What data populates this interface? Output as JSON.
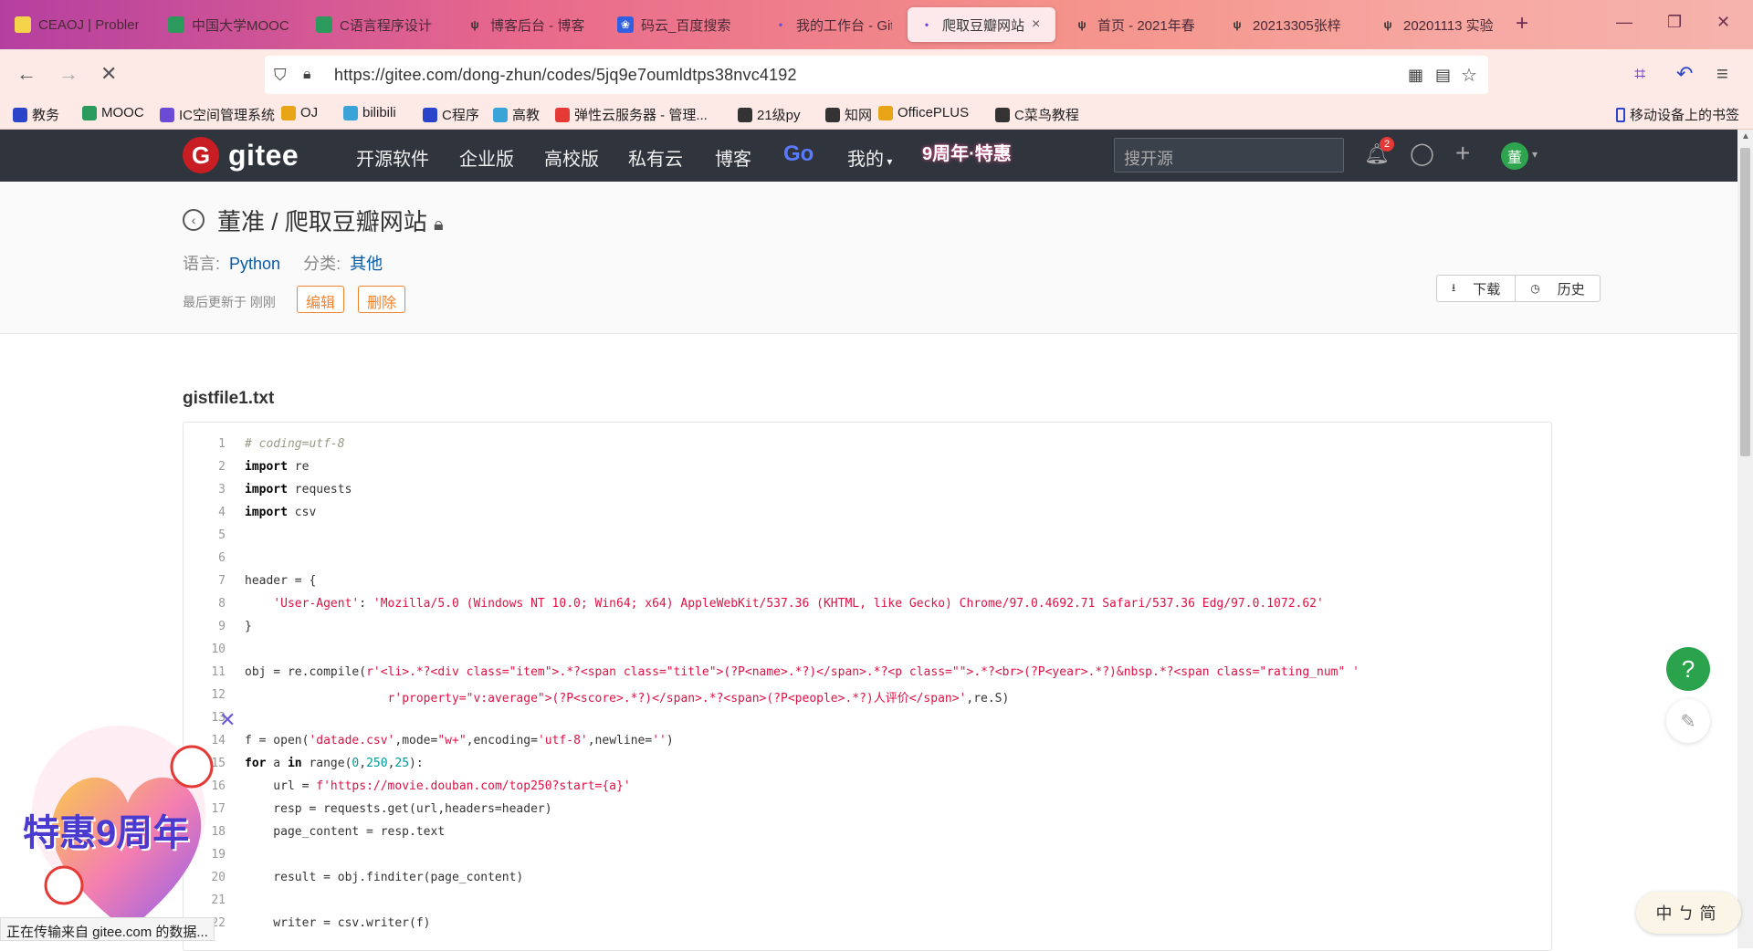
{
  "browser": {
    "tabs": [
      {
        "label": "CEAOJ | Problem",
        "icon": "ceaoj-icon"
      },
      {
        "label": "中国大学MOOC",
        "icon": "mooc-icon"
      },
      {
        "label": "C语言程序设计",
        "icon": "mooc-icon"
      },
      {
        "label": "博客后台 - 博客",
        "icon": "cnblogs-icon"
      },
      {
        "label": "码云_百度搜索",
        "icon": "baidu-icon"
      },
      {
        "label": "我的工作台 - Gitee",
        "icon": "dot-icon"
      },
      {
        "label": "爬取豆瓣网站",
        "icon": "dot-icon",
        "active": true
      },
      {
        "label": "首页 - 2021年春",
        "icon": "cnblogs-icon"
      },
      {
        "label": "20213305张梓",
        "icon": "cnblogs-icon"
      },
      {
        "label": "20201113 实验",
        "icon": "cnblogs-icon"
      }
    ],
    "tab_close": "×",
    "new_tab": "+",
    "url": "https://gitee.com/dong-zhun/codes/5jq9e7oumldtps38nvc4192",
    "bookmarks": [
      "教务",
      "MOOC",
      "IC空间管理系统",
      "OJ",
      "bilibili",
      "C程序",
      "高教",
      "弹性云服务器 - 管理...",
      "21级py",
      "知网",
      "OfficePLUS",
      "C菜鸟教程"
    ],
    "mobile_bookmarks": "移动设备上的书签",
    "status_text": "正在传输来自 gitee.com 的数据..."
  },
  "gitee": {
    "logo_text": "gitee",
    "nav": [
      "开源软件",
      "企业版",
      "高校版",
      "私有云",
      "博客",
      "Go",
      "我的"
    ],
    "anniversary": "9周年·特惠",
    "search_placeholder": "搜开源",
    "notification_count": "2",
    "avatar_text": "董"
  },
  "snippet": {
    "owner": "董准",
    "separator": " / ",
    "name": "爬取豆瓣网站",
    "lang_label": "语言:",
    "lang_value": "Python",
    "cat_label": "分类:",
    "cat_value": "其他",
    "updated": "最后更新于 刚刚",
    "edit": "编辑",
    "delete": "删除",
    "download": "下载",
    "history": "历史",
    "filename": "gistfile1.txt"
  },
  "code_lines": [
    "# coding=utf-8",
    "import re",
    "import requests",
    "import csv",
    "",
    "",
    "header = {",
    "    'User-Agent': 'Mozilla/5.0 (Windows NT 10.0; Win64; x64) AppleWebKit/537.36 (KHTML, like Gecko) Chrome/97.0.4692.71 Safari/537.36 Edg/97.0.1072.62'",
    "}",
    "",
    "obj = re.compile(r'<li>.*?<div class=\"item\">.*?<span class=\"title\">(?P<name>.*?)</span>.*?<p class=\"\">.*?<br>(?P<year>.*?)&nbsp.*?<span class=\"rating_num\" '",
    "                    r'property=\"v:average\">(?P<score>.*?)</span>.*?<span>(?P<people>.*?)人评价</span>',re.S)",
    "",
    "f = open('datade.csv',mode=\"w+\",encoding='utf-8',newline='')",
    "for a in range(0,250,25):",
    "    url = f'https://movie.douban.com/top250?start={a}'",
    "    resp = requests.get(url,headers=header)",
    "    page_content = resp.text",
    "",
    "    result = obj.finditer(page_content)",
    "",
    "    writer = csv.writer(f)"
  ],
  "promo": {
    "text": "特惠9周年"
  },
  "float": {
    "help": "?",
    "tool": "中ㄅ简"
  },
  "colors": {
    "tabbar_start": "#b53fa0",
    "gitee_red": "#c71d23",
    "accent_orange": "#f0822c",
    "link_blue": "#095aa5",
    "help_green": "#2ba24c"
  }
}
